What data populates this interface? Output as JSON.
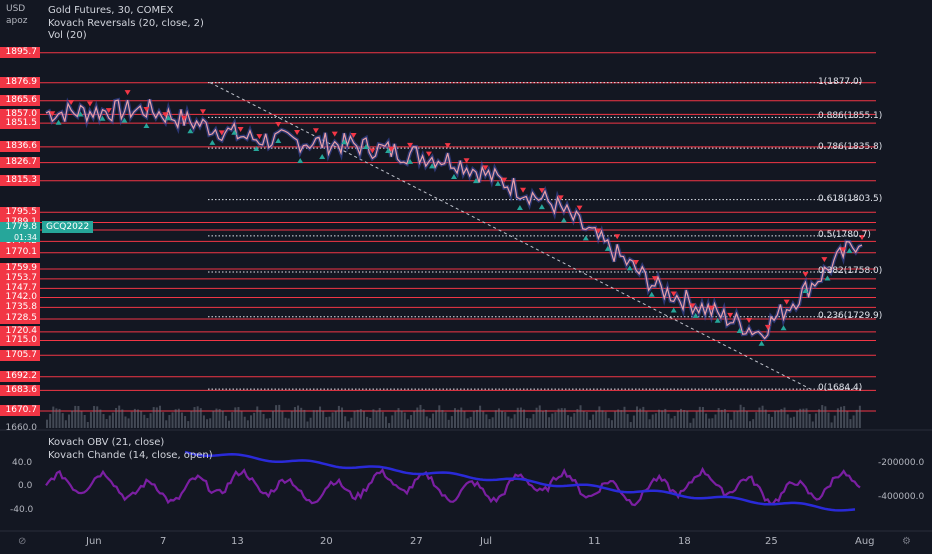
{
  "header": {
    "currency": "USD",
    "user": "apoz",
    "legend": [
      "Gold Futures, 30, COMEX",
      "Kovach Reversals (20, close, 2)",
      "Vol (20)"
    ]
  },
  "price_axis": {
    "red_levels": [
      "1895.7",
      "1876.9",
      "1865.6",
      "1857.0",
      "1851.5",
      "1836.6",
      "1826.7",
      "1815.3",
      "1795.5",
      "1789.1",
      "1784.4",
      "1777.2",
      "1770.1",
      "1759.9",
      "1753.7",
      "1747.7",
      "1742.0",
      "1735.8",
      "1728.5",
      "1720.4",
      "1715.0",
      "1705.7",
      "1692.2",
      "1683.6",
      "1670.7"
    ],
    "plain_levels": [
      "1660.0"
    ],
    "current_price": "1779.8",
    "current_countdown": "01:34",
    "symbol_badge": "GCQ2022"
  },
  "fibonacci": [
    {
      "label": "1(1877.0)",
      "level": 1877.0
    },
    {
      "label": "0.886(1855.1)",
      "level": 1855.1
    },
    {
      "label": "0.786(1835.8)",
      "level": 1835.8
    },
    {
      "label": "0.618(1803.5)",
      "level": 1803.5
    },
    {
      "label": "0.5(1780.7)",
      "level": 1780.7
    },
    {
      "label": "0.382(1758.0)",
      "level": 1758.0
    },
    {
      "label": "0.236(1729.9)",
      "level": 1729.9
    },
    {
      "label": "0(1684.4)",
      "level": 1684.4
    }
  ],
  "sub_pane": {
    "legend": [
      "Kovach OBV (21, close)",
      "Kovach Chande (14, close, open)"
    ],
    "left_ticks": [
      "40.0",
      "0.0",
      "-40.0"
    ],
    "right_ticks": [
      "-200000.0",
      "-400000.0"
    ]
  },
  "time_axis": {
    "labels": [
      "Jun",
      "7",
      "13",
      "20",
      "27",
      "Jul",
      "11",
      "18",
      "25",
      "Aug"
    ]
  },
  "colors": {
    "background": "#131722",
    "level_line": "#f23645",
    "candle": "#e8a0a8",
    "bull": "#26a69a",
    "bear": "#f23645",
    "obv": "#2a2ad8",
    "chande": "#7b1fa2"
  },
  "chart_data": {
    "type": "line",
    "title": "Gold Futures, 30, COMEX",
    "x": [
      "Jun",
      "7",
      "13",
      "20",
      "27",
      "Jul",
      "11",
      "18",
      "25"
    ],
    "series": [
      {
        "name": "Gold Futures",
        "values": [
          1858,
          1860,
          1842,
          1838,
          1828,
          1800,
          1748,
          1720,
          1780
        ]
      }
    ],
    "ylim": [
      1660,
      1905
    ]
  }
}
